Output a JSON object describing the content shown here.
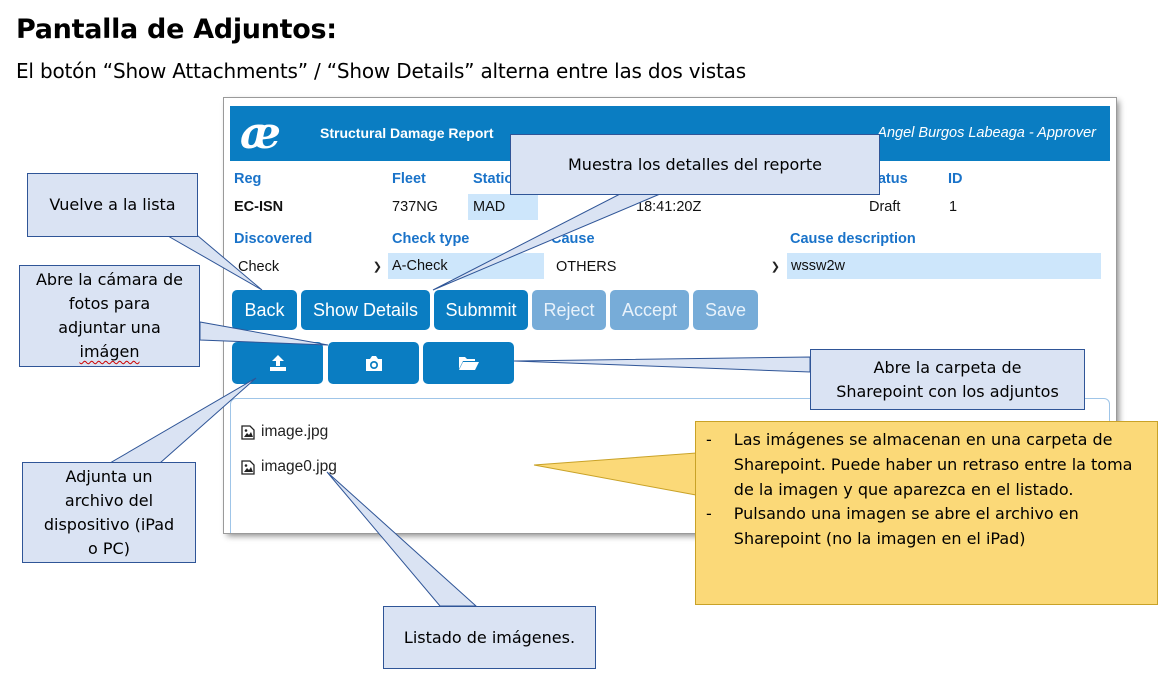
{
  "slide": {
    "title": "Pantalla de Adjuntos:",
    "subtitle": "El botón “Show Attachments” / “Show Details” alterna entre las dos vistas"
  },
  "app": {
    "logo": "æ",
    "title": "Structural Damage Report",
    "user": "Angel Burgos Labeaga - Approver",
    "fields": {
      "reg_label": "Reg",
      "reg_value": "EC-ISN",
      "fleet_label": "Fleet",
      "fleet_value": "737NG",
      "station_label": "Statio",
      "station_value": "MAD",
      "date_fragment": "18:41:20Z",
      "status_label": "tatus",
      "status_value": "Draft",
      "id_label": "ID",
      "id_value": "1",
      "discovered_label": "Discovered",
      "discovered_value": "Check",
      "checktype_label": "Check type",
      "checktype_value": "A-Check",
      "cause_label": "Cause",
      "cause_value": "OTHERS",
      "causedesc_label": "Cause description",
      "causedesc_value": "wssw2w"
    },
    "buttons": {
      "back": "Back",
      "show_details": "Show Details",
      "submmit": "Submmit",
      "reject": "Reject",
      "accept": "Accept",
      "save": "Save"
    },
    "icon_buttons": [
      "upload-icon",
      "camera-icon",
      "folder-open-icon"
    ],
    "files": [
      "image.jpg",
      "image0.jpg"
    ],
    "colors": {
      "header": "#0a7dc2",
      "label": "#1a73c9",
      "disabled": "#77acd8"
    }
  },
  "callouts": {
    "detalles": "Muestra los detalles del reporte",
    "lista": "Vuelve  a la lista",
    "camara": [
      "Abre la cámara de",
      "fotos para",
      "adjuntar una",
      "imágen"
    ],
    "carpeta": [
      "Abre la carpeta de",
      "Sharepoint con los adjuntos"
    ],
    "adjunta": [
      "Adjunta un",
      "archivo del",
      "dispositivo (iPad",
      "o PC)"
    ],
    "listado": "Listado de imágenes.",
    "notas": [
      "Las imágenes se almacenan en una carpeta de Sharepoint. Puede haber un retraso entre la toma de la imagen y que aparezca en el listado.",
      "Pulsando una imagen se abre el archivo en Sharepoint (no la imagen en el iPad)"
    ],
    "bullet": "-"
  }
}
